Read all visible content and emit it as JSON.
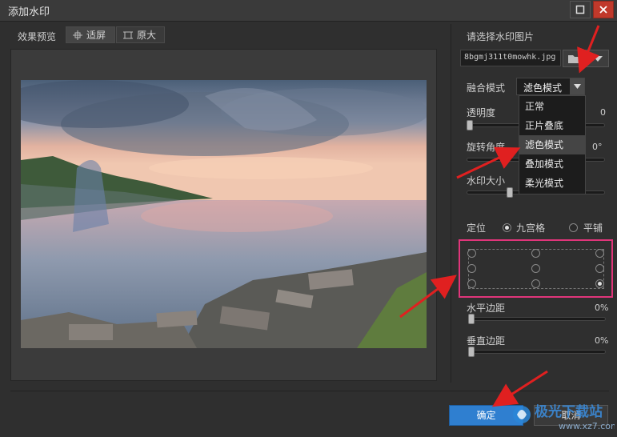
{
  "window": {
    "title": "添加水印"
  },
  "preview": {
    "label": "效果预览",
    "fit_label": "适屏",
    "original_label": "原大"
  },
  "watermark_image": {
    "label": "请选择水印图片",
    "filename": "8bgmj311t0mowhk.jpg"
  },
  "blend": {
    "label": "融合模式",
    "selected": "滤色模式",
    "options": [
      "正常",
      "正片叠底",
      "滤色模式",
      "叠加模式",
      "柔光模式"
    ],
    "selected_index": 2
  },
  "sliders": {
    "opacity": {
      "label": "透明度",
      "value": "0",
      "fraction": 0.0
    },
    "rotation": {
      "label": "旋转角度",
      "value": "0°"
    },
    "size": {
      "label": "水印大小",
      "fraction": 0.28
    },
    "h_margin": {
      "label": "水平边距",
      "value": "0%",
      "fraction": 0.0
    },
    "v_margin": {
      "label": "垂直边距",
      "value": "0%",
      "fraction": 0.0
    }
  },
  "position": {
    "label": "定位",
    "mode_grid": "九宫格",
    "mode_tile": "平铺",
    "selected_mode": "九宫格",
    "selected_cell": 8
  },
  "buttons": {
    "ok": "确定",
    "cancel": "取消"
  },
  "site_logo": {
    "text": "极光下载站",
    "url_text": "www.xz7.com"
  },
  "colors": {
    "accent_blue": "#2f7fd0",
    "highlight_pink": "#e0357a",
    "arrow_red": "#e02020"
  }
}
